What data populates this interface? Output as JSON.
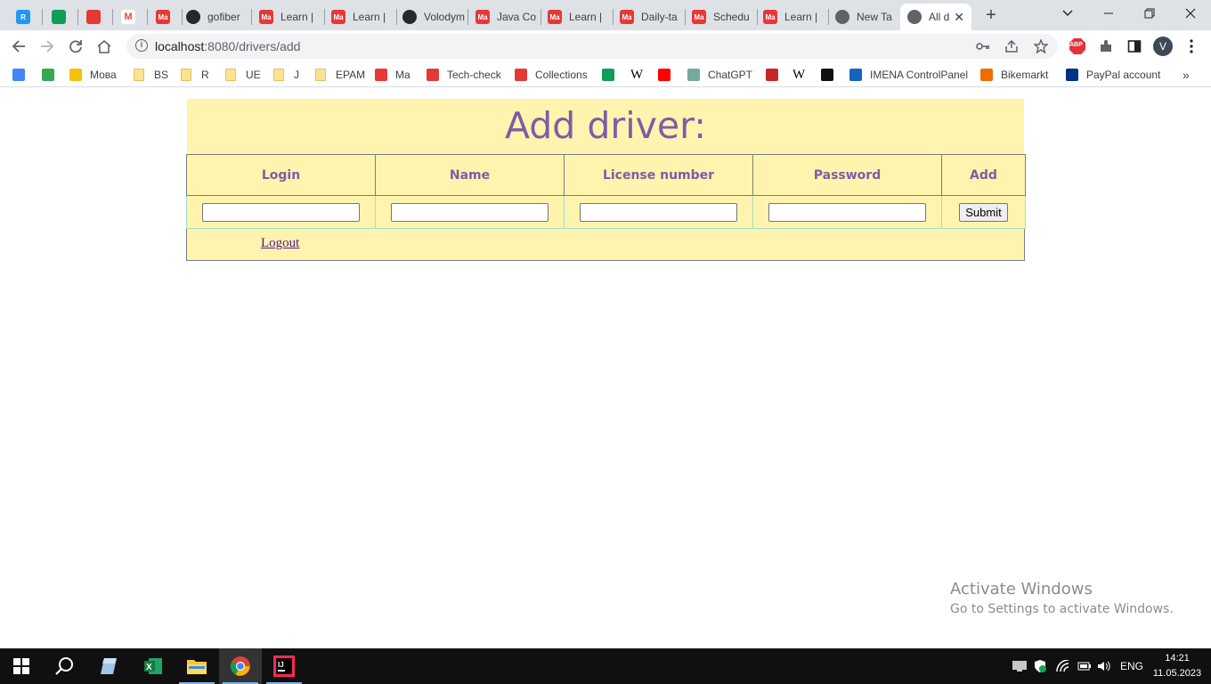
{
  "browser": {
    "tabs": [
      {
        "label": "",
        "color": "#2196f3",
        "glyph": "R"
      },
      {
        "label": "",
        "color": "#0f9d58",
        "glyph": ""
      },
      {
        "label": "",
        "color": "#e53935",
        "glyph": ""
      },
      {
        "label": "",
        "color": "#ffffff",
        "glyph": "M"
      },
      {
        "label": "",
        "color": "#e53935",
        "glyph": "Ma"
      },
      {
        "label": "gofiber",
        "color": "#24292f",
        "glyph": ""
      },
      {
        "label": "Learn |",
        "color": "#e53935",
        "glyph": "Ma"
      },
      {
        "label": "Learn |",
        "color": "#e53935",
        "glyph": "Ma"
      },
      {
        "label": "Volodym",
        "color": "#24292f",
        "glyph": ""
      },
      {
        "label": "Java Co",
        "color": "#e53935",
        "glyph": "Ma"
      },
      {
        "label": "Learn |",
        "color": "#e53935",
        "glyph": "Ma"
      },
      {
        "label": "Daily-ta",
        "color": "#e53935",
        "glyph": "Ma"
      },
      {
        "label": "Schedu",
        "color": "#e53935",
        "glyph": "Ma"
      },
      {
        "label": "Learn |",
        "color": "#e53935",
        "glyph": "Ma"
      },
      {
        "label": "New Ta",
        "color": "#5f6368",
        "glyph": ""
      },
      {
        "label": "All d",
        "color": "#5f6368",
        "glyph": ""
      }
    ],
    "url_host": "localhost",
    "url_path": ":8080/drivers/add",
    "profile_initial": "V",
    "abp_label": "ABP"
  },
  "bookmarks": [
    {
      "label": "",
      "type": "icon",
      "color": "#4285f4"
    },
    {
      "label": "",
      "type": "icon",
      "color": "#34a853"
    },
    {
      "label": "Мова",
      "type": "icon",
      "color": "#f4c20d"
    },
    {
      "label": "BS",
      "type": "folder"
    },
    {
      "label": "R",
      "type": "folder"
    },
    {
      "label": "UE",
      "type": "folder"
    },
    {
      "label": "J",
      "type": "folder"
    },
    {
      "label": "EPAM",
      "type": "folder"
    },
    {
      "label": "Ma",
      "type": "icon",
      "color": "#e53935"
    },
    {
      "label": "Tech-check",
      "type": "icon",
      "color": "#e53935"
    },
    {
      "label": "Collections",
      "type": "icon",
      "color": "#e53935"
    },
    {
      "label": "",
      "type": "icon",
      "color": "#0f9d58"
    },
    {
      "label": "",
      "type": "text",
      "glyph": "W"
    },
    {
      "label": "",
      "type": "icon",
      "color": "#ff0000"
    },
    {
      "label": "ChatGPT",
      "type": "icon",
      "color": "#74aa9c"
    },
    {
      "label": "",
      "type": "icon",
      "color": "#c62828"
    },
    {
      "label": "",
      "type": "text",
      "glyph": "W"
    },
    {
      "label": "",
      "type": "icon",
      "color": "#111111"
    },
    {
      "label": "IMENA ControlPanel",
      "type": "icon",
      "color": "#1565c0"
    },
    {
      "label": "Bikemarkt",
      "type": "icon",
      "color": "#ef6c00"
    },
    {
      "label": "PayPal account",
      "type": "icon",
      "color": "#003087"
    }
  ],
  "page": {
    "title": "Add driver:",
    "columns": [
      "Login",
      "Name",
      "License number",
      "Password",
      "Add"
    ],
    "inputs": {
      "login": "",
      "name": "",
      "license_number": "",
      "password": ""
    },
    "submit_label": "Submit",
    "logout_label": "Logout"
  },
  "watermark": {
    "line1": "Activate Windows",
    "line2": "Go to Settings to activate Windows."
  },
  "taskbar": {
    "language": "ENG",
    "time": "14:21",
    "date": "11.05.2023"
  },
  "colors": {
    "page_bg_yellow": "#fef4ae",
    "heading_purple": "#7b5ea7"
  }
}
